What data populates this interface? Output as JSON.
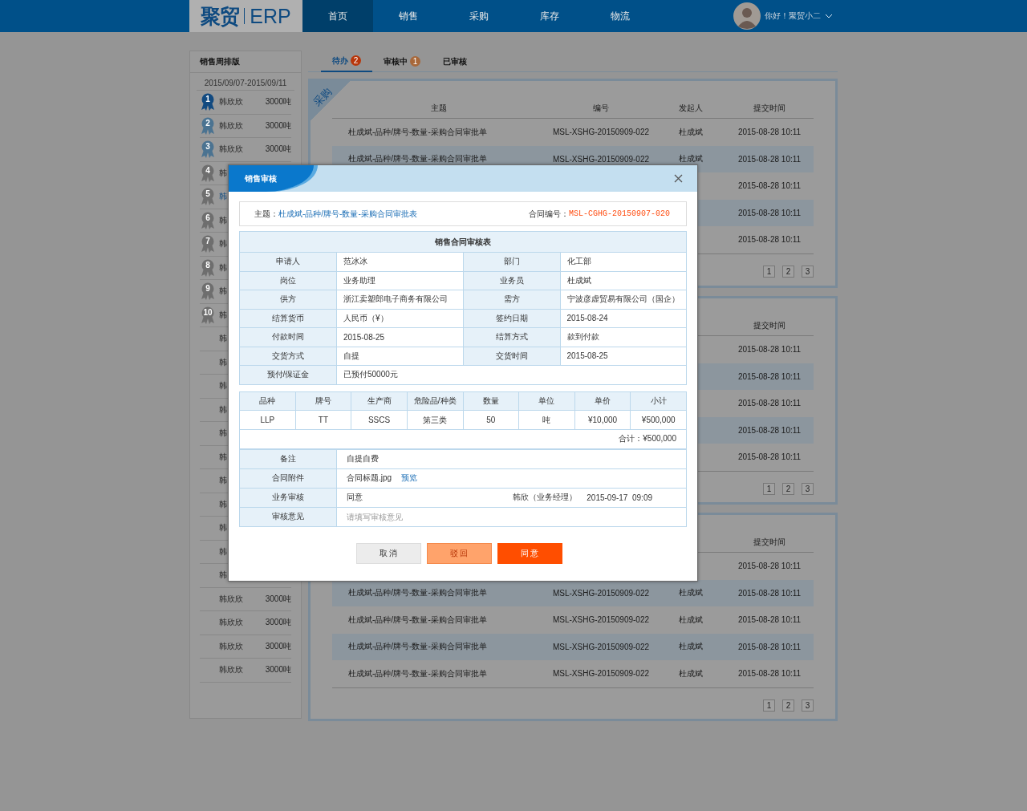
{
  "header": {
    "logo_mark": "聚贸",
    "logo_text": "ERP",
    "nav": [
      {
        "label": "首页",
        "selected": true
      },
      {
        "label": "销售",
        "selected": false
      },
      {
        "label": "采购",
        "selected": false
      },
      {
        "label": "库存",
        "selected": false
      },
      {
        "label": "物流",
        "selected": false
      }
    ],
    "user": {
      "greeting": "你好！聚贸小二"
    }
  },
  "sidebar": {
    "title": "销售周排版",
    "date_range": "2015/09/07-2015/09/11",
    "items": [
      {
        "rank": "1",
        "color": "#124a80",
        "name": "韩欣欣",
        "amount": "3000吨",
        "selected": false
      },
      {
        "rank": "2",
        "color": "#4b7391",
        "name": "韩欣欣",
        "amount": "3000吨",
        "selected": false
      },
      {
        "rank": "3",
        "color": "#4b7391",
        "name": "韩欣欣",
        "amount": "3000吨",
        "selected": false
      },
      {
        "rank": "4",
        "color": "#6e6e6e",
        "name": "韩",
        "selected": false
      },
      {
        "rank": "5",
        "color": "#6e6e6e",
        "name": "韩",
        "selected": true
      },
      {
        "rank": "6",
        "color": "#6e6e6e",
        "name": "韩",
        "selected": false
      },
      {
        "rank": "7",
        "color": "#6e6e6e",
        "name": "韩",
        "selected": false
      },
      {
        "rank": "8",
        "color": "#6e6e6e",
        "name": "韩",
        "selected": false
      },
      {
        "rank": "9",
        "color": "#6e6e6e",
        "name": "韩",
        "selected": false
      },
      {
        "rank": "10",
        "color": "#6e6e6e",
        "name": "韩",
        "selected": false
      },
      {
        "name": "韩",
        "selected": false
      },
      {
        "name": "韩",
        "selected": false
      },
      {
        "name": "韩",
        "selected": false
      },
      {
        "name": "韩",
        "selected": false
      },
      {
        "name": "韩",
        "selected": false
      },
      {
        "name": "韩",
        "selected": false
      },
      {
        "name": "韩",
        "selected": false
      },
      {
        "name": "韩",
        "selected": false
      },
      {
        "name": "韩",
        "selected": false
      },
      {
        "name": "韩",
        "selected": false
      },
      {
        "name": "韩",
        "selected": false
      },
      {
        "name": "韩欣欣",
        "amount": "3000吨",
        "selected": false
      },
      {
        "name": "韩欣欣",
        "amount": "3000吨",
        "selected": false
      },
      {
        "name": "韩欣欣",
        "amount": "3000吨",
        "selected": false
      },
      {
        "name": "韩欣欣",
        "amount": "3000吨",
        "selected": false
      }
    ]
  },
  "tabs": [
    {
      "label": "待办",
      "badge": "2",
      "color": "#b8360a",
      "selected": true
    },
    {
      "label": "审核中",
      "badge": "1",
      "color": "#a8683a",
      "selected": false
    },
    {
      "label": "已审核",
      "selected": false
    }
  ],
  "panels": [
    {
      "corner_label": "采购",
      "header": {
        "subject": "主题",
        "number": "编号",
        "sender": "发起人",
        "time": "提交时间"
      },
      "rows": [
        {
          "subject": "杜成斌-品种/牌号-数量-采购合同审批单",
          "number": "MSL-XSHG-20150909-022",
          "sender": "杜成斌",
          "time": "2015-08-28 10:11"
        },
        {
          "subject": "杜成斌-品种/牌号-数量-采购合同审批单",
          "number": "MSL-XSHG-20150909-022",
          "sender": "杜成斌",
          "time": "2015-08-28 10:11"
        },
        {
          "time": "2015-08-28 10:11"
        },
        {
          "time": "2015-08-28 10:11"
        },
        {
          "time": "2015-08-28 10:11"
        }
      ],
      "pages": [
        "1",
        "2",
        "3"
      ]
    },
    {
      "header": {
        "time": "提交时间"
      },
      "rows": [
        {
          "time": "2015-08-28 10:11"
        },
        {
          "time": "2015-08-28 10:11"
        },
        {
          "time": "2015-08-28 10:11"
        },
        {
          "time": "2015-08-28 10:11"
        },
        {
          "time": "2015-08-28 10:11"
        }
      ],
      "pages": [
        "1",
        "2",
        "3"
      ]
    },
    {
      "header": {
        "time": "提交时间"
      },
      "rows": [
        {
          "time": "2015-08-28 10:11"
        },
        {
          "subject": "杜成斌-品种/牌号-数量-采购合同审批单",
          "number": "MSL-XSHG-20150909-022",
          "sender": "杜成斌",
          "time": "2015-08-28 10:11"
        },
        {
          "subject": "杜成斌-品种/牌号-数量-采购合同审批单",
          "number": "MSL-XSHG-20150909-022",
          "sender": "杜成斌",
          "time": "2015-08-28 10:11"
        },
        {
          "subject": "杜成斌-品种/牌号-数量-采购合同审批单",
          "number": "MSL-XSHG-20150909-022",
          "sender": "杜成斌",
          "time": "2015-08-28 10:11"
        },
        {
          "subject": "杜成斌-品种/牌号-数量-采购合同审批单",
          "number": "MSL-XSHG-20150909-022",
          "sender": "杜成斌",
          "time": "2015-08-28 10:11"
        }
      ],
      "pages": [
        "1",
        "2",
        "3"
      ]
    }
  ],
  "modal": {
    "title": "销售审核",
    "subject_label": "主题：",
    "subject": "杜成斌-品种/牌号-数量-采购合同审批表",
    "contract_label": "合同编号：",
    "contract_no": "MSL-CGHG-20150907-020",
    "form": {
      "title": "销售合同审核表",
      "rows": [
        [
          {
            "label": "申请人",
            "value": "范冰冰"
          },
          {
            "label": "部门",
            "value": "化工部"
          }
        ],
        [
          {
            "label": "岗位",
            "value": "业务助理"
          },
          {
            "label": "业务员",
            "value": "杜成斌"
          }
        ],
        [
          {
            "label": "供方",
            "value": "浙江卖塑郎电子商务有限公司"
          },
          {
            "label": "需方",
            "value": "宁波彦虚贸易有限公司（国企）"
          }
        ],
        [
          {
            "label": "结算货币",
            "value": "人民币（¥）"
          },
          {
            "label": "签约日期",
            "value": "2015-08-24"
          }
        ],
        [
          {
            "label": "付款时间",
            "value": "2015-08-25"
          },
          {
            "label": "结算方式",
            "value": "款到付款"
          }
        ],
        [
          {
            "label": "交货方式",
            "value": "自提"
          },
          {
            "label": "交货时间",
            "value": "2015-08-25"
          }
        ],
        [
          {
            "label": "预付/保证金",
            "value": "已预付50000元"
          }
        ]
      ]
    },
    "items": {
      "columns": [
        "品种",
        "牌号",
        "生产商",
        "危险品/种类",
        "数量",
        "单位",
        "单价",
        "小计"
      ],
      "rows": [
        [
          "LLP",
          "TT",
          "SSCS",
          "第三类",
          "50",
          "吨",
          "¥10,000",
          "¥500,000"
        ]
      ],
      "total": "合计：¥500,000"
    },
    "review": [
      {
        "kind": "text",
        "label": "备注",
        "value": "自提自费"
      },
      {
        "kind": "attachment",
        "label": "合同附件",
        "value": "合同标题.jpg",
        "link": "预览"
      },
      {
        "kind": "approval",
        "label": "业务审核",
        "value": "同意",
        "by": "韩欣（业务经理）",
        "time": "2015-09-17  09:09"
      },
      {
        "kind": "input",
        "label": "审核意见",
        "placeholder": "请填写审核意见"
      }
    ],
    "buttons": [
      {
        "kind": "cancel",
        "label": "取 消"
      },
      {
        "kind": "reject",
        "label": "驳 回"
      },
      {
        "kind": "approve",
        "label": "同 意"
      }
    ]
  }
}
